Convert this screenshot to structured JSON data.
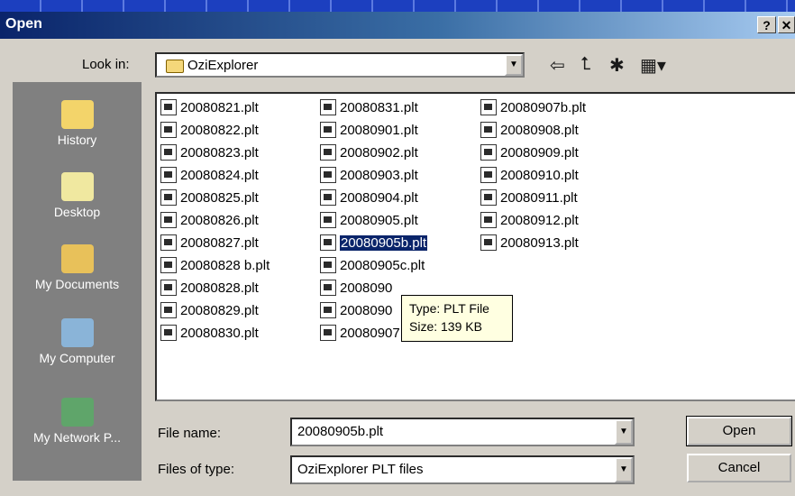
{
  "window": {
    "title": "Open",
    "help_icon": "help-icon",
    "close_icon": "close-icon"
  },
  "lookin": {
    "label": "Look in:",
    "value": "OziExplorer"
  },
  "toolbar": {
    "icons": [
      "back-icon",
      "up-folder-icon",
      "new-folder-icon",
      "view-menu-icon"
    ]
  },
  "places": [
    {
      "label": "History",
      "icon": "history-icon"
    },
    {
      "label": "Desktop",
      "icon": "desktop-icon"
    },
    {
      "label": "My Documents",
      "icon": "documents-icon"
    },
    {
      "label": "My Computer",
      "icon": "computer-icon"
    },
    {
      "label": "My Network P...",
      "icon": "network-icon"
    }
  ],
  "files": {
    "col1": [
      "20080821.plt",
      "20080822.plt",
      "20080823.plt",
      "20080824.plt",
      "20080825.plt",
      "20080826.plt",
      "20080827.plt",
      "20080828 b.plt",
      "20080828.plt",
      "20080829.plt",
      "20080830.plt"
    ],
    "col2": [
      "20080831.plt",
      "20080901.plt",
      "20080902.plt",
      "20080903.plt",
      "20080904.plt",
      "20080905.plt",
      "20080905b.plt",
      "20080905c.plt",
      "2008090",
      "2008090",
      "20080907.plt"
    ],
    "col3": [
      "20080907b.plt",
      "20080908.plt",
      "20080909.plt",
      "20080910.plt",
      "20080911.plt",
      "20080912.plt",
      "20080913.plt"
    ],
    "selected": "20080905b.plt"
  },
  "tooltip": {
    "type": "Type: PLT File",
    "size": "Size: 139 KB"
  },
  "filename": {
    "label": "File name:",
    "value": "20080905b.plt"
  },
  "filetype": {
    "label": "Files of type:",
    "value": "OziExplorer PLT files"
  },
  "buttons": {
    "open": "Open",
    "cancel": "Cancel"
  }
}
